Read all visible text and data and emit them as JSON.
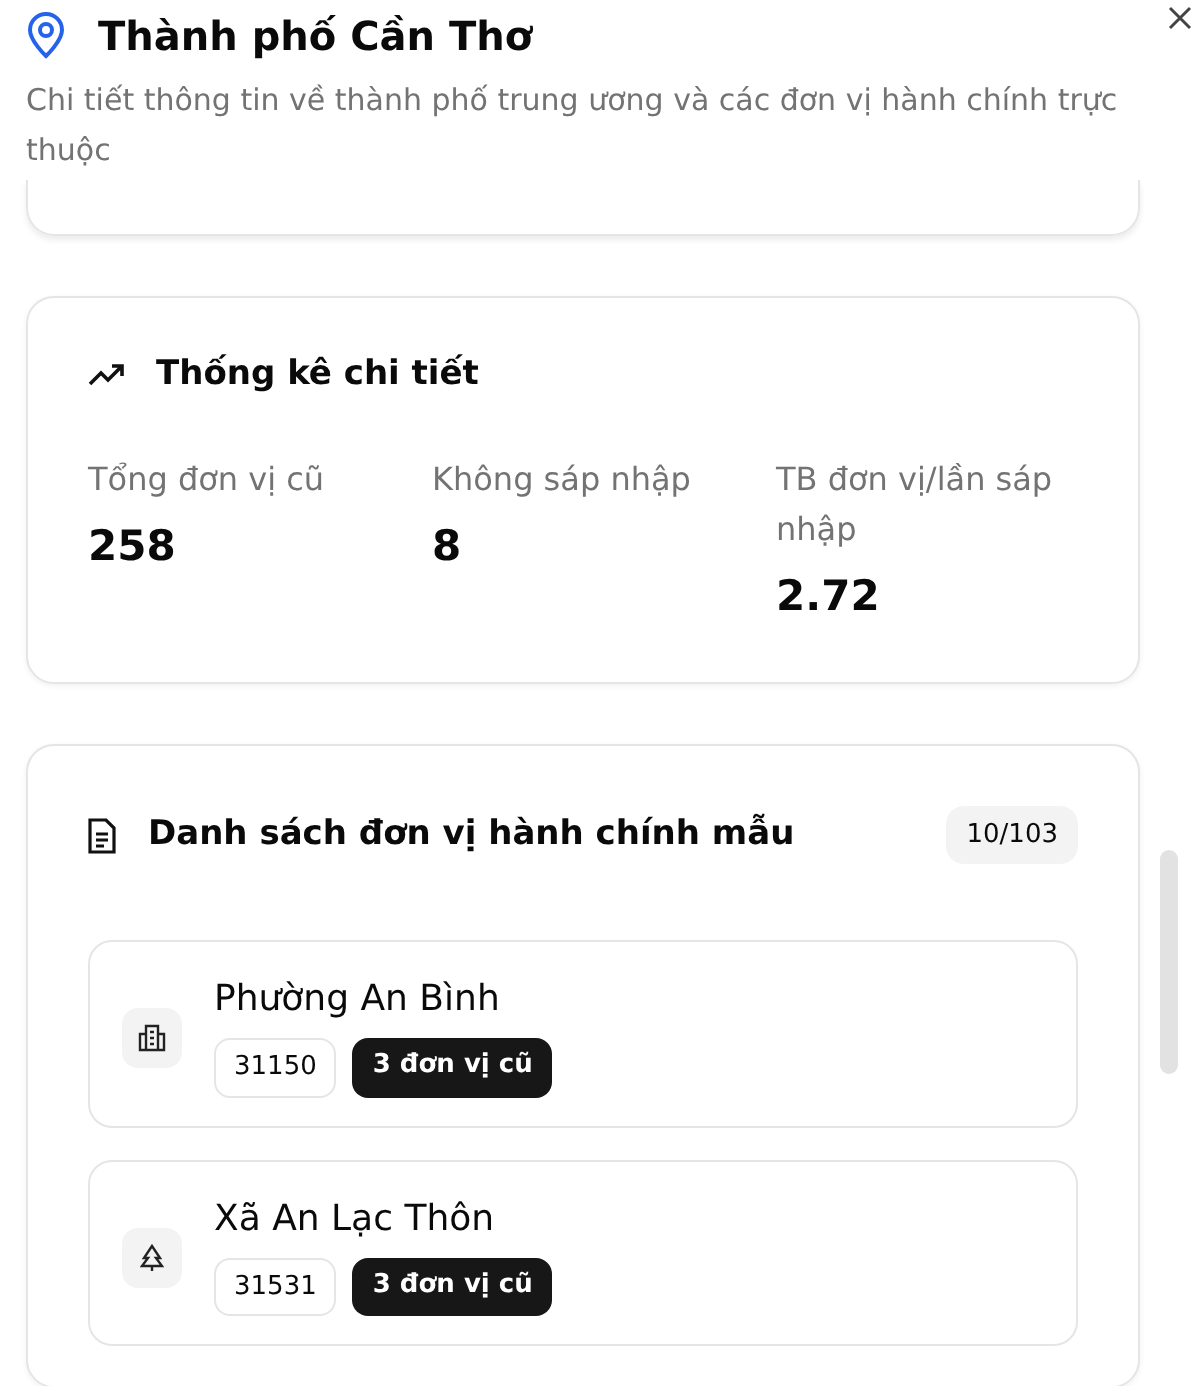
{
  "header": {
    "title": "Thành phố Cần Thơ",
    "subtitle": "Chi tiết thông tin về thành phố trung ương và các đơn vị hành chính trực thuộc"
  },
  "stats": {
    "title": "Thống kê chi tiết",
    "items": [
      {
        "label": "Tổng đơn vị cũ",
        "value": "258"
      },
      {
        "label": "Không sáp nhập",
        "value": "8"
      },
      {
        "label": "TB đơn vị/lần sáp nhập",
        "value": "2.72"
      }
    ]
  },
  "units": {
    "title": "Danh sách đơn vị hành chính mẫu",
    "count": "10/103",
    "items": [
      {
        "kind": "ward",
        "name": "Phường An Bình",
        "code": "31150",
        "old_units": "3 đơn vị cũ"
      },
      {
        "kind": "commune",
        "name": "Xã An Lạc Thôn",
        "code": "31531",
        "old_units": "3 đơn vị cũ"
      }
    ]
  }
}
